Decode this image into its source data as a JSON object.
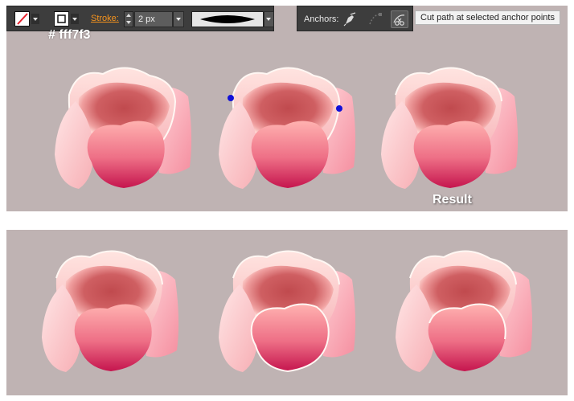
{
  "toolbar": {
    "stroke_label": "Stroke:",
    "stroke_weight": "2 px"
  },
  "anchors": {
    "label": "Anchors:",
    "tooltip": "Cut path at selected anchor points"
  },
  "labels": {
    "hex": "# fff7f3",
    "result": "Result"
  },
  "colors": {
    "background": "#bfb3b3",
    "toolbar": "#3d3d3d",
    "stroke_label": "#f7941d",
    "highlight": "#fff7f3",
    "anchor": "#1010d8"
  }
}
